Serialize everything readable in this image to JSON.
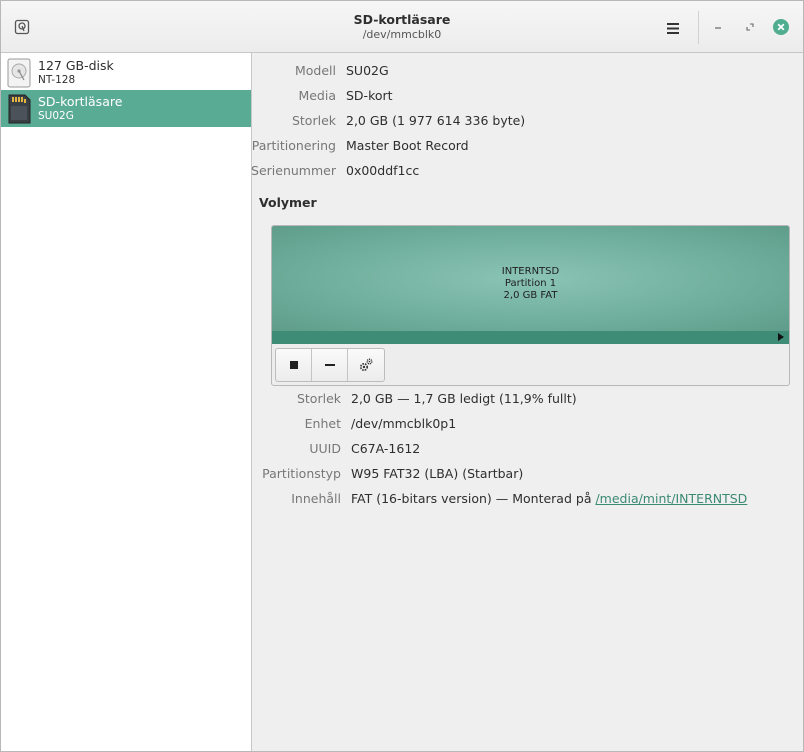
{
  "header": {
    "title": "SD-kortläsare",
    "subtitle": "/dev/mmcblk0"
  },
  "icons": {
    "app": "disk-app-icon",
    "menu": "hamburger-menu-icon",
    "minimize": "minimize-icon",
    "maximize": "maximize-icon",
    "close": "close-icon",
    "stop": "stop-icon",
    "remove": "minus-icon",
    "settings": "gears-icon"
  },
  "colors": {
    "accent": "#5aab93",
    "partition": "#7ab8a6",
    "link": "#3b8a73"
  },
  "sidebar": {
    "drives": [
      {
        "name": "127 GB-disk",
        "sub": "NT-128",
        "selected": false
      },
      {
        "name": "SD-kortläsare",
        "sub": "SU02G",
        "selected": true
      }
    ]
  },
  "drive_info": [
    {
      "label": "Modell",
      "value": "SU02G"
    },
    {
      "label": "Media",
      "value": "SD-kort"
    },
    {
      "label": "Storlek",
      "value": "2,0 GB (1 977 614 336 byte)"
    },
    {
      "label": "Partitionering",
      "value": "Master Boot Record"
    },
    {
      "label": "Serienummer",
      "value": "0x00ddf1cc"
    }
  ],
  "volumes": {
    "title": "Volymer",
    "partition": {
      "name": "INTERNTSD",
      "number": "Partition 1",
      "size_fs": "2,0 GB FAT"
    }
  },
  "volume_info": [
    {
      "label": "Storlek",
      "value": "2,0 GB — 1,7 GB ledigt (11,9% fullt)"
    },
    {
      "label": "Enhet",
      "value": "/dev/mmcblk0p1"
    },
    {
      "label": "UUID",
      "value": "C67A-1612"
    },
    {
      "label": "Partitionstyp",
      "value": "W95 FAT32 (LBA) (Startbar)"
    },
    {
      "label": "Innehåll",
      "value": "FAT (16-bitars version) — Monterad på ",
      "link": "/media/mint/INTERNTSD"
    }
  ]
}
